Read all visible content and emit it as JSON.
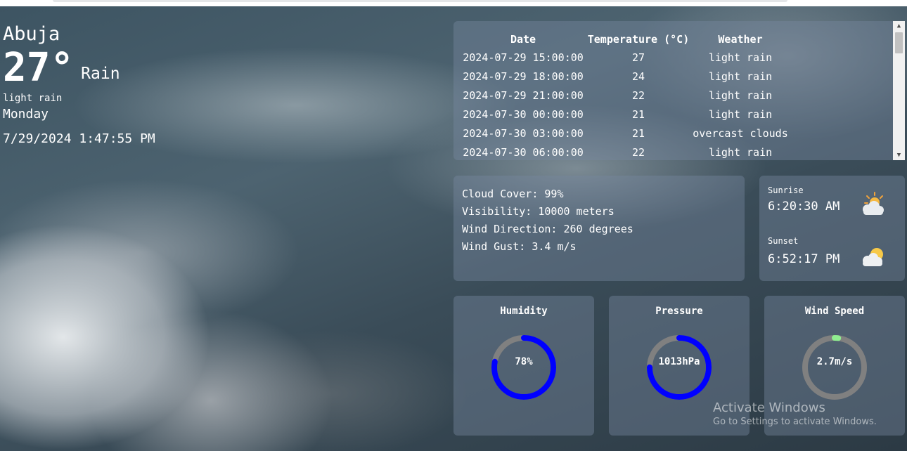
{
  "current": {
    "city": "Abuja",
    "temperature": "27°",
    "condition": "Rain",
    "description": "light rain",
    "day": "Monday",
    "datetime": "7/29/2024 1:47:55 PM"
  },
  "forecast": {
    "headers": [
      "Date",
      "Temperature (°C)",
      "Weather"
    ],
    "rows": [
      {
        "date": "2024-07-29 15:00:00",
        "temp": "27",
        "weather": "light rain"
      },
      {
        "date": "2024-07-29 18:00:00",
        "temp": "24",
        "weather": "light rain"
      },
      {
        "date": "2024-07-29 21:00:00",
        "temp": "22",
        "weather": "light rain"
      },
      {
        "date": "2024-07-30 00:00:00",
        "temp": "21",
        "weather": "light rain"
      },
      {
        "date": "2024-07-30 03:00:00",
        "temp": "21",
        "weather": "overcast clouds"
      },
      {
        "date": "2024-07-30 06:00:00",
        "temp": "22",
        "weather": "light rain"
      }
    ],
    "scroll_up_glyph": "▲",
    "scroll_down_glyph": "▼"
  },
  "details": {
    "cloud_cover": "Cloud Cover: 99%",
    "visibility": "Visibility: 10000 meters",
    "wind_direction": "Wind Direction: 260 degrees",
    "wind_gust": "Wind Gust: 3.4 m/s"
  },
  "sun": {
    "sunrise_label": "Sunrise",
    "sunrise_time": "6:20:30 AM",
    "sunrise_icon": "sun-behind-cloud-icon",
    "sunset_label": "Sunset",
    "sunset_time": "6:52:17 PM",
    "sunset_icon": "sun-behind-cloud-icon"
  },
  "gauges": {
    "humidity": {
      "title": "Humidity",
      "value": "78%",
      "fraction": 0.78,
      "color": "#0000ff"
    },
    "pressure": {
      "title": "Pressure",
      "value": "1013hPa",
      "fraction": 0.75,
      "color": "#0000ff"
    },
    "wind_speed": {
      "title": "Wind Speed",
      "value": "2.7m/s",
      "fraction": 0.02,
      "color": "#90ee90"
    }
  },
  "gauge_track_color": "#808080",
  "watermark": {
    "title": "Activate Windows",
    "subtitle": "Go to Settings to activate Windows."
  }
}
